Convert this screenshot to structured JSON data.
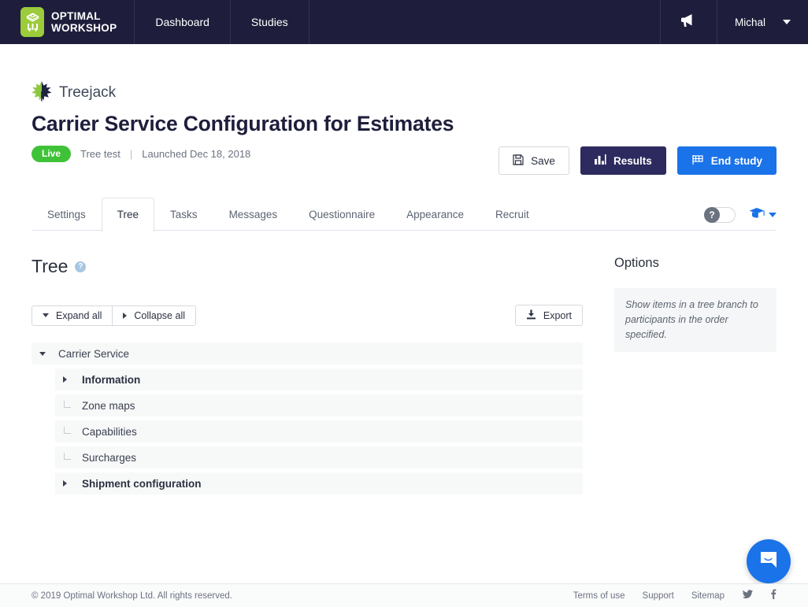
{
  "topnav": {
    "brand": {
      "line1": "OPTIMAL",
      "line2": "WORKSHOP",
      "icon": "optimal-workshop-logo"
    },
    "links": [
      {
        "label": "Dashboard",
        "name": "nav-link-dashboard"
      },
      {
        "label": "Studies",
        "name": "nav-link-studies"
      }
    ],
    "announcements_icon": "megaphone-icon",
    "user": {
      "name": "Michal",
      "caret_icon": "chevron-down-icon"
    }
  },
  "study": {
    "product_icon": "treejack-leaf-icon",
    "product": "Treejack",
    "title": "Carrier Service Configuration for Estimates",
    "status_badge": "Live",
    "type": "Tree test",
    "separator": "|",
    "launched": "Launched Dec 18, 2018",
    "actions": [
      {
        "label": "Save",
        "icon": "floppy-disk-icon",
        "style": "outline"
      },
      {
        "label": "Results",
        "icon": "bar-chart-icon",
        "style": "dark"
      },
      {
        "label": "End study",
        "icon": "flag-icon",
        "style": "primary"
      }
    ]
  },
  "tabs": {
    "items": [
      {
        "label": "Settings",
        "active": false
      },
      {
        "label": "Tree",
        "active": true
      },
      {
        "label": "Tasks",
        "active": false
      },
      {
        "label": "Messages",
        "active": false
      },
      {
        "label": "Questionnaire",
        "active": false
      },
      {
        "label": "Appearance",
        "active": false
      },
      {
        "label": "Recruit",
        "active": false
      }
    ],
    "help_toggle": {
      "icon": "question-mark-icon",
      "state": "off"
    },
    "learn_menu": {
      "icon": "graduation-cap-icon",
      "caret_icon": "chevron-down-icon"
    }
  },
  "tree_section": {
    "heading": "Tree",
    "help_icon": "question-mark-circle-icon",
    "expand_all": {
      "label": "Expand all",
      "icon": "caret-down-icon"
    },
    "collapse_all": {
      "label": "Collapse all",
      "icon": "caret-right-icon"
    },
    "export": {
      "label": "Export",
      "icon": "download-icon"
    },
    "nodes": [
      {
        "label": "Carrier Service",
        "level": 0,
        "marker": "caret-down-icon",
        "bold": false
      },
      {
        "label": "Information",
        "level": 1,
        "marker": "caret-right-icon",
        "bold": true
      },
      {
        "label": "Zone maps",
        "level": 1,
        "marker": "leaf-corner-icon",
        "bold": false
      },
      {
        "label": "Capabilities",
        "level": 1,
        "marker": "leaf-corner-icon",
        "bold": false
      },
      {
        "label": "Surcharges",
        "level": 1,
        "marker": "leaf-corner-icon",
        "bold": false
      },
      {
        "label": "Shipment configuration",
        "level": 1,
        "marker": "caret-right-icon",
        "bold": true
      }
    ]
  },
  "options_panel": {
    "title": "Options",
    "hint": "Show items in a tree branch to participants in the order specified."
  },
  "footer": {
    "copyright": "© 2019 Optimal Workshop Ltd. All rights reserved.",
    "links": [
      "Terms of use",
      "Support",
      "Sitemap"
    ],
    "social": [
      "twitter-icon",
      "facebook-icon"
    ]
  },
  "chat": {
    "icon": "chat-bubble-icon"
  },
  "colors": {
    "nav_bg": "#1e1e3c",
    "brand_green": "#9ccb3b",
    "live_green": "#3fc238",
    "primary_blue": "#1a73e8",
    "results_navy": "#2c2a5e",
    "row_bg": "#f7f8f8"
  }
}
